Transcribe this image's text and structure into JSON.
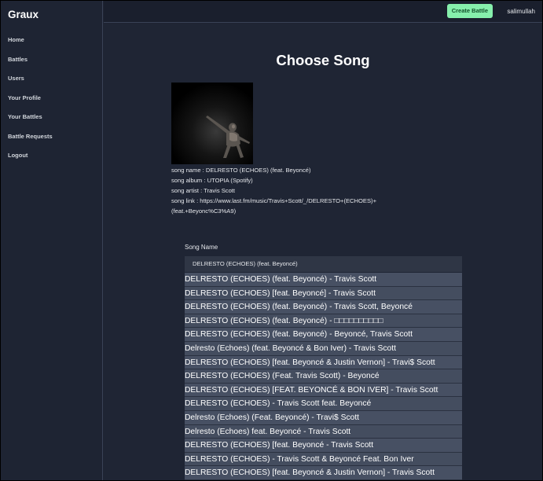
{
  "sidebar": {
    "brand": "Graux",
    "items": [
      {
        "label": "Home"
      },
      {
        "label": "Battles"
      },
      {
        "label": "Users"
      },
      {
        "label": "Your Profile"
      },
      {
        "label": "Your Battles"
      },
      {
        "label": "Battle Requests"
      },
      {
        "label": "Logout"
      }
    ]
  },
  "header": {
    "create_battle_label": "Create Battle",
    "username": "salimullah"
  },
  "main": {
    "title": "Choose Song",
    "song_info": {
      "name": "song name : DELRESTO (ECHOES) (feat. Beyoncé)",
      "album": "song album : UTOPIA (Spotify)",
      "artist": "song artist : Travis Scott",
      "link_line1": "song link : https://www.last.fm/music/Travis+Scott/_/DELRESTO+(ECHOES)+",
      "link_line2": "(feat.+Beyonc%C3%A9)"
    },
    "form": {
      "label": "Song Name",
      "value": "DELRESTO (ECHOES) (feat. Beyoncé)"
    },
    "results": [
      "DELRESTO (ECHOES) (feat. Beyoncé) - Travis Scott",
      "DELRESTO (ECHOES) [feat. Beyoncé] - Travis Scott",
      "DELRESTO (ECHOES) (feat. Beyoncé) - Travis Scott, Beyoncé",
      "DELRESTO (ECHOES) (feat. Beyoncé) - □□□□□□□□□□",
      "DELRESTO (ECHOES) (feat. Beyoncé) - Beyoncé, Travis Scott",
      "Delresto (Echoes) (feat. Beyoncé & Bon Iver) - Travis Scott",
      "DELRESTO (ECHOES) [feat. Beyoncé & Justin Vernon] - Travi$ Scott",
      "DELRESTO (ECHOES) (Feat. Travis Scott) - Beyoncé",
      "DELRESTO (ECHOES) [FEAT. BEYONCÉ & BON IVER] - Travis Scott",
      "DELRESTO (ECHOES) - Travis Scott feat. Beyoncé",
      "Delresto (Echoes) (Feat. Beyoncé) - Travi$ Scott",
      "Delresto (Echoes) feat. Beyoncé - Travis Scott",
      "DELRESTO (ECHOES) [feat. Beyoncé - Travis Scott",
      "DELRESTO (ECHOES) - Travis Scott & Beyoncé Feat. Bon Iver",
      "DELRESTO (ECHOES) [feat. Beyoncé & Justin Vernon] - Travis Scott"
    ]
  }
}
